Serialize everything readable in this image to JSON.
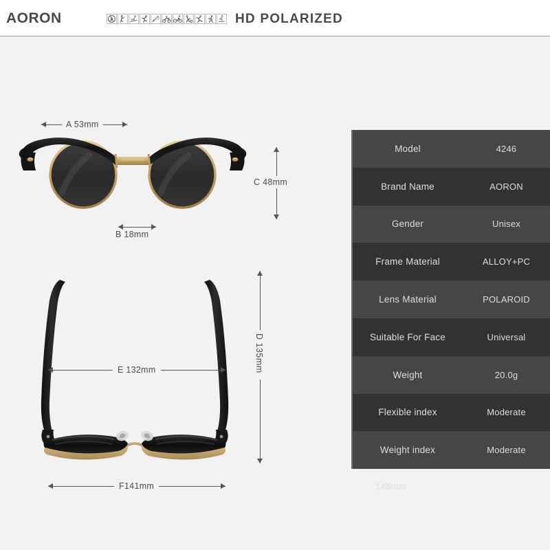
{
  "header": {
    "brand": "AORON",
    "tagline": "HD POLARIZED",
    "icons": [
      "driving-icon",
      "golf-icon",
      "skiing-icon",
      "running-icon",
      "fishing-icon",
      "motorcycling-icon",
      "cycling-icon",
      "soccer-icon",
      "climbing-icon",
      "hiking-icon",
      "skateboarding-icon"
    ]
  },
  "diagram": {
    "front_view_name": "sunglasses-front-view",
    "top_view_name": "sunglasses-top-view",
    "measurements": {
      "a": "A 53mm",
      "b": "B 18mm",
      "c": "C 48mm",
      "d": "D 135mm",
      "e": "E 132mm",
      "f": "F141mm"
    }
  },
  "spec_table": {
    "rows": [
      {
        "key": "Model",
        "value": "4246"
      },
      {
        "key": "Brand Name",
        "value": "AORON"
      },
      {
        "key": "Gender",
        "value": "Unisex"
      },
      {
        "key": "Frame Material",
        "value": "ALLOY+PC"
      },
      {
        "key": "Lens Material",
        "value": "POLAROID"
      },
      {
        "key": "Suitable For Face",
        "value": "Universal"
      },
      {
        "key": "Weight",
        "value": "20.0g"
      },
      {
        "key": "Flexible index",
        "value": "Moderate"
      },
      {
        "key": "Weight index",
        "value": "Moderate"
      }
    ]
  },
  "footer_note": "148mm",
  "colors": {
    "page_background": "#f2f2f2",
    "header_background": "#ffffff",
    "text_dark": "#4a4a4a",
    "table_row_odd": "#464646",
    "table_row_even": "#323232",
    "table_text": "#dedede",
    "frame_black": "#1a1a1a",
    "frame_gold": "#c9a96a"
  }
}
